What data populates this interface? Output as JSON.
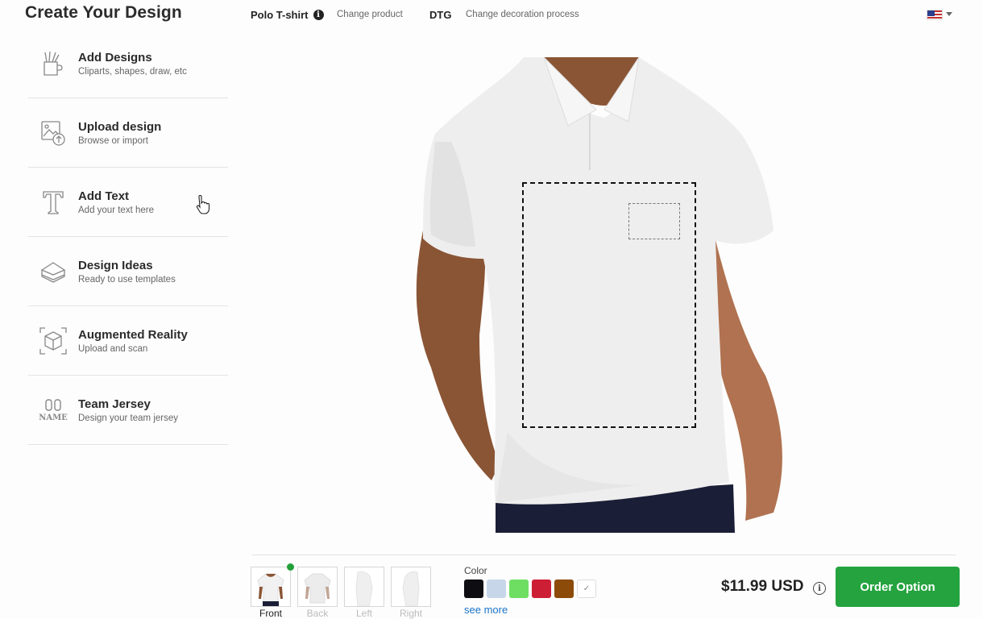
{
  "header": {
    "title": "Create Your Design",
    "product_name": "Polo T-shirt",
    "product_info_icon": "info-icon",
    "change_product": "Change product",
    "process": "DTG",
    "change_process": "Change decoration process",
    "language_flag": "us-flag-icon"
  },
  "sidebar": {
    "items": [
      {
        "title": "Add Designs",
        "subtitle": "Cliparts, shapes, draw, etc",
        "icon": "pencil-cup-icon"
      },
      {
        "title": "Upload design",
        "subtitle": "Browse or import",
        "icon": "upload-image-icon"
      },
      {
        "title": "Add Text",
        "subtitle": "Add your text here",
        "icon": "text-t-icon"
      },
      {
        "title": "Design Ideas",
        "subtitle": "Ready to use templates",
        "icon": "templates-icon"
      },
      {
        "title": "Augmented Reality",
        "subtitle": "Upload and scan",
        "icon": "ar-cube-icon"
      },
      {
        "title": "Team Jersey",
        "subtitle": "Design your team jersey",
        "icon": "jersey-number-icon",
        "icon_text": "NAME"
      }
    ]
  },
  "views": [
    {
      "label": "Front",
      "active": true
    },
    {
      "label": "Back",
      "active": false
    },
    {
      "label": "Left",
      "active": false
    },
    {
      "label": "Right",
      "active": false
    }
  ],
  "colors": {
    "label": "Color",
    "swatches": [
      "#0d0d12",
      "#c8d6ea",
      "#6ede63",
      "#cc1f35",
      "#8c4b08"
    ],
    "see_more": "see more"
  },
  "price": "$11.99 USD",
  "order_button": "Order Option"
}
